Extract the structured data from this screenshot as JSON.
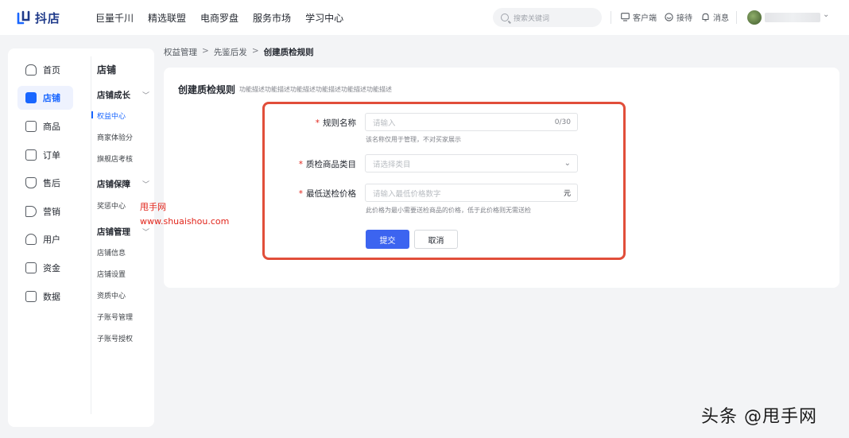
{
  "header": {
    "logo_text": "抖店",
    "nav": [
      "巨量千川",
      "精选联盟",
      "电商罗盘",
      "服务市场",
      "学习中心"
    ],
    "search_placeholder": "搜索关键词",
    "tools": {
      "client": "客户端",
      "reception": "接待",
      "message": "消息"
    }
  },
  "sidebar": {
    "primary": [
      {
        "label": "首页",
        "icon": "home-icon"
      },
      {
        "label": "店铺",
        "icon": "store-icon"
      },
      {
        "label": "商品",
        "icon": "product-icon"
      },
      {
        "label": "订单",
        "icon": "order-icon"
      },
      {
        "label": "售后",
        "icon": "aftersale-icon"
      },
      {
        "label": "营销",
        "icon": "marketing-icon"
      },
      {
        "label": "用户",
        "icon": "user-icon"
      },
      {
        "label": "资金",
        "icon": "wallet-icon"
      },
      {
        "label": "数据",
        "icon": "chart-icon"
      }
    ],
    "secondary_title": "店铺",
    "groups": [
      {
        "label": "店铺成长",
        "items": [
          "权益中心",
          "商家体验分",
          "旗舰店考核"
        ]
      },
      {
        "label": "店铺保障",
        "items": [
          "奖惩中心"
        ]
      },
      {
        "label": "店铺管理",
        "items": [
          "店铺信息",
          "店铺设置",
          "资质中心",
          "子账号管理",
          "子账号授权"
        ]
      }
    ]
  },
  "breadcrumb": [
    "权益管理",
    "先鉴后发",
    "创建质检规则"
  ],
  "page": {
    "title": "创建质检规则",
    "description": "功能描述功能描述功能描述功能描述功能描述功能描述"
  },
  "form": {
    "rule_name": {
      "label": "规则名称",
      "placeholder": "请输入",
      "counter": "0/30",
      "hint": "该名称仅用于管理，不对买家展示"
    },
    "category": {
      "label": "质检商品类目",
      "placeholder": "请选择类目"
    },
    "min_price": {
      "label": "最低送检价格",
      "placeholder": "请输入最低价格数字",
      "suffix": "元",
      "hint": "此价格为最小需要送检商品的价格，低于此价格则无需送检"
    },
    "submit_label": "提交",
    "cancel_label": "取消",
    "required_mark": "*"
  },
  "watermarks": {
    "site_name": "甩手网",
    "site_url": "www.shuaishou.com",
    "bottom": "头条 @甩手网"
  },
  "colors": {
    "accent": "#1966ff",
    "button_primary": "#3c64f0",
    "highlight_border": "#e14e3a",
    "watermark": "#e1251b"
  }
}
